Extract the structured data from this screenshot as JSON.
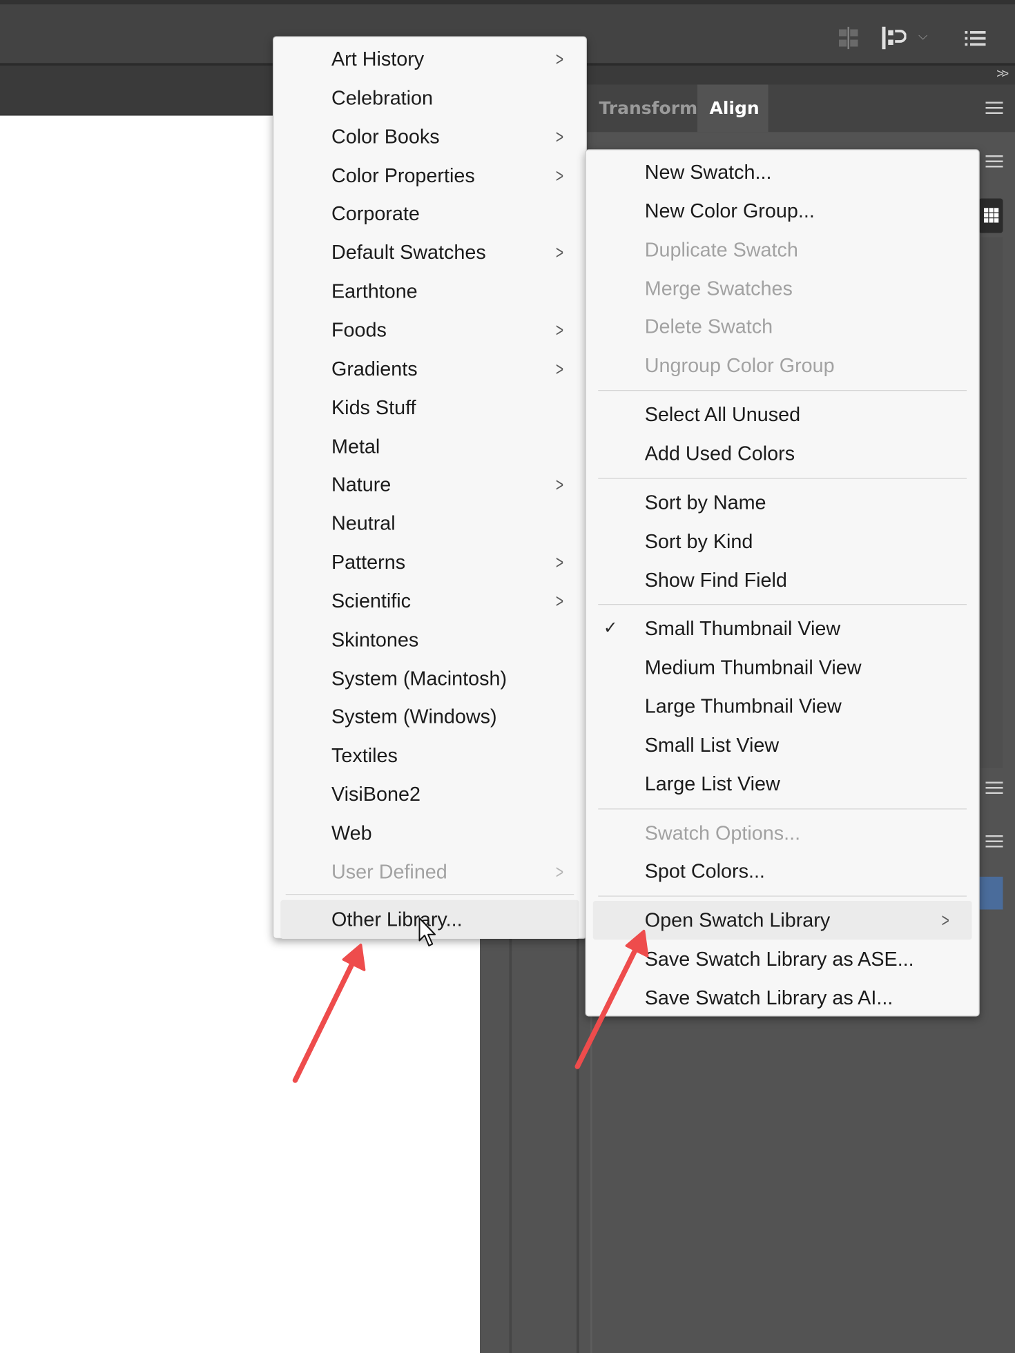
{
  "colors": {
    "accent_arrow": "#ee4c4c",
    "menu_bg": "#f7f7f7",
    "panel_dark": "#535353",
    "selection_blue": "#4a6c9b"
  },
  "panel_tabs": {
    "transform": "Transform",
    "align": "Align"
  },
  "topbar": {
    "collapse_label": ">>"
  },
  "library_menu": {
    "items": [
      {
        "label": "Art History",
        "submenu": true
      },
      {
        "label": "Celebration",
        "submenu": false
      },
      {
        "label": "Color Books",
        "submenu": true
      },
      {
        "label": "Color Properties",
        "submenu": true
      },
      {
        "label": "Corporate",
        "submenu": false
      },
      {
        "label": "Default Swatches",
        "submenu": true
      },
      {
        "label": "Earthtone",
        "submenu": false
      },
      {
        "label": "Foods",
        "submenu": true
      },
      {
        "label": "Gradients",
        "submenu": true
      },
      {
        "label": "Kids Stuff",
        "submenu": false
      },
      {
        "label": "Metal",
        "submenu": false
      },
      {
        "label": "Nature",
        "submenu": true
      },
      {
        "label": "Neutral",
        "submenu": false
      },
      {
        "label": "Patterns",
        "submenu": true
      },
      {
        "label": "Scientific",
        "submenu": true
      },
      {
        "label": "Skintones",
        "submenu": false
      },
      {
        "label": "System (Macintosh)",
        "submenu": false
      },
      {
        "label": "System (Windows)",
        "submenu": false
      },
      {
        "label": "Textiles",
        "submenu": false
      },
      {
        "label": "VisiBone2",
        "submenu": false
      },
      {
        "label": "Web",
        "submenu": false
      },
      {
        "label": "User Defined",
        "submenu": true,
        "disabled": true
      }
    ],
    "other_library": "Other Library..."
  },
  "panel_menu": {
    "groups": [
      [
        {
          "label": "New Swatch..."
        },
        {
          "label": "New Color Group..."
        },
        {
          "label": "Duplicate Swatch",
          "disabled": true
        },
        {
          "label": "Merge Swatches",
          "disabled": true
        },
        {
          "label": "Delete Swatch",
          "disabled": true
        },
        {
          "label": "Ungroup Color Group",
          "disabled": true
        }
      ],
      [
        {
          "label": "Select All Unused"
        },
        {
          "label": "Add Used Colors"
        }
      ],
      [
        {
          "label": "Sort by Name"
        },
        {
          "label": "Sort by Kind"
        },
        {
          "label": "Show Find Field"
        }
      ],
      [
        {
          "label": "Small Thumbnail View",
          "checked": true
        },
        {
          "label": "Medium Thumbnail View"
        },
        {
          "label": "Large Thumbnail View"
        },
        {
          "label": "Small List View"
        },
        {
          "label": "Large List View"
        }
      ],
      [
        {
          "label": "Swatch Options...",
          "disabled": true
        },
        {
          "label": "Spot Colors..."
        }
      ],
      [
        {
          "label": "Open Swatch Library",
          "submenu": true,
          "highlighted": true
        },
        {
          "label": "Save Swatch Library as ASE..."
        },
        {
          "label": "Save Swatch Library as AI..."
        }
      ]
    ]
  }
}
